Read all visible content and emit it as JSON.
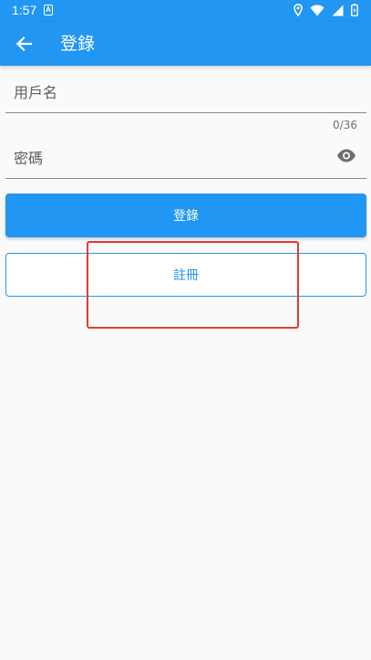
{
  "status_bar": {
    "time": "1:57",
    "app_indicator": "A",
    "icons": [
      "location-icon",
      "wifi-icon",
      "signal-icon",
      "battery-icon"
    ]
  },
  "app_bar": {
    "title": "登錄",
    "back_icon": "arrow-back-icon"
  },
  "form": {
    "username_label": "用戶名",
    "password_label": "密碼",
    "password_counter": "0/36",
    "visibility_icon": "eye-icon"
  },
  "actions": {
    "login_label": "登錄",
    "register_label": "註冊"
  },
  "colors": {
    "primary": "#2196f3",
    "highlight": "#e53935"
  }
}
